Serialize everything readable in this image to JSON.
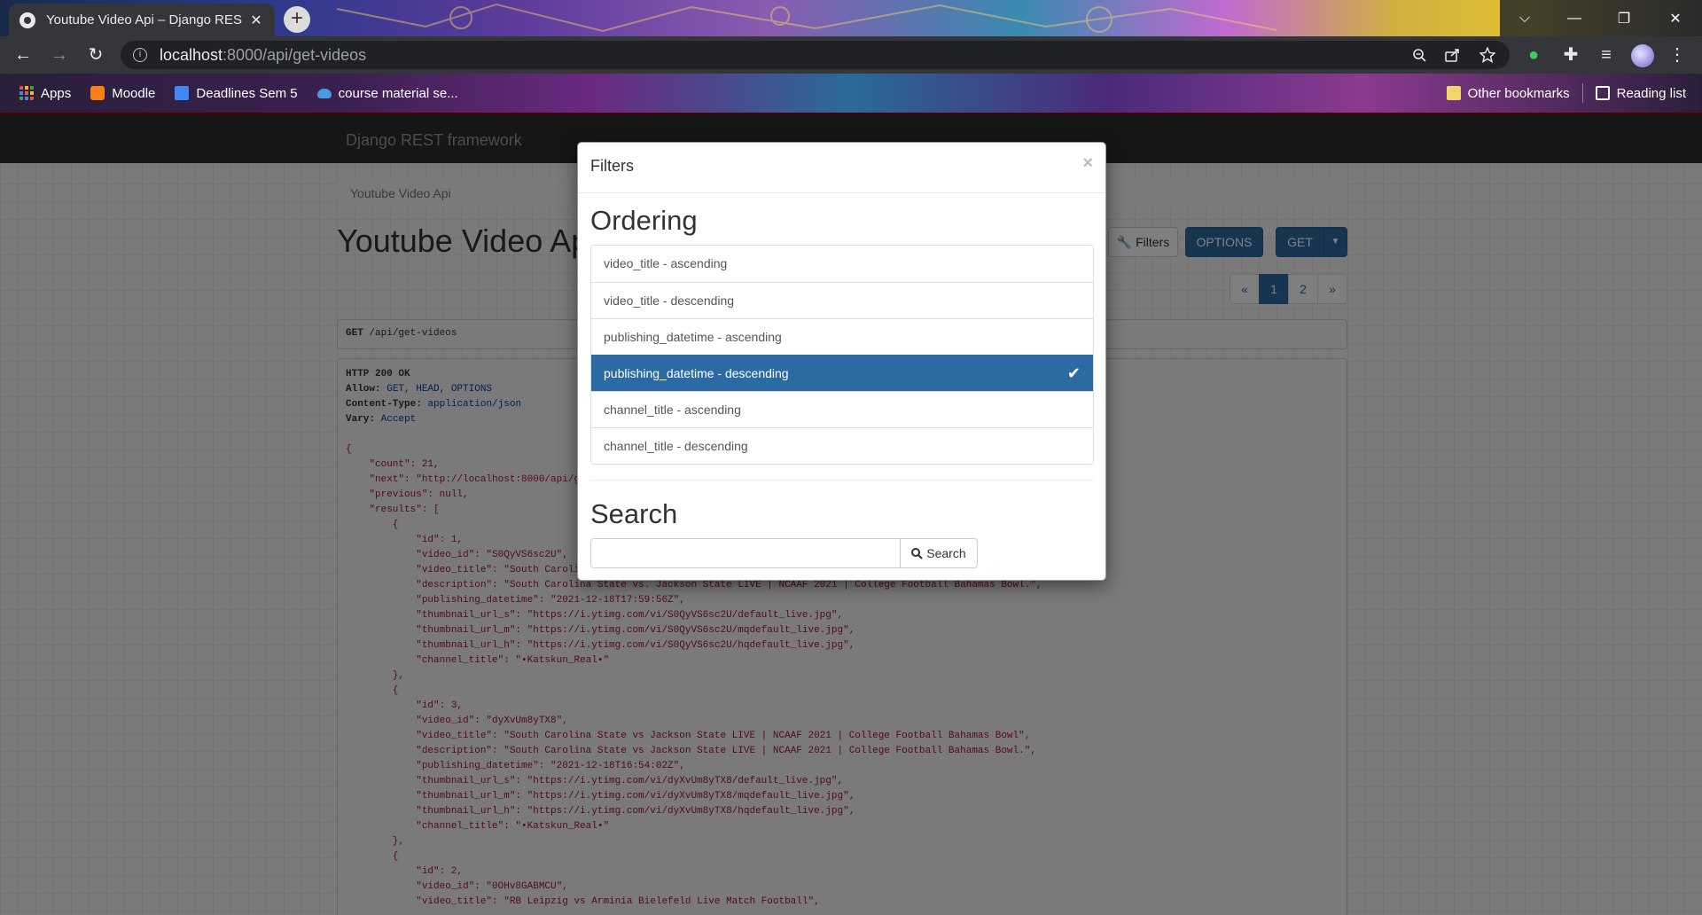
{
  "browser": {
    "tab_title": "Youtube Video Api – Django RES",
    "tab_close": "✕",
    "new_tab": "+",
    "url_host": "localhost",
    "url_path": ":8000/api/get-videos",
    "window_controls": [
      "⌵",
      "—",
      "❐",
      "✕"
    ]
  },
  "bookmarks": {
    "items": [
      {
        "label": "Apps",
        "icon": "apps-grid-icon",
        "color": "#e9573f"
      },
      {
        "label": "Moodle",
        "icon": "moodle-icon",
        "color": "#f98012"
      },
      {
        "label": "Deadlines Sem 5",
        "icon": "docs-icon",
        "color": "#4285f4"
      },
      {
        "label": "course material se...",
        "icon": "onedrive-icon",
        "color": "#4a9ae0"
      }
    ],
    "other": "Other bookmarks",
    "reading_list": "Reading list"
  },
  "app": {
    "brand": "Django REST framework",
    "breadcrumb": "Youtube Video Api",
    "page_title": "Youtube Video Api",
    "filters_label": "Filters",
    "options_label": "OPTIONS",
    "get_label": "GET",
    "pagination": [
      "«",
      "1",
      "2",
      "»"
    ],
    "request_method": "GET",
    "request_path": "/api/get-videos"
  },
  "response": {
    "status": "HTTP 200 OK",
    "headers": [
      {
        "name": "Allow:",
        "value": "GET, HEAD, OPTIONS"
      },
      {
        "name": "Content-Type:",
        "value": "application/json"
      },
      {
        "name": "Vary:",
        "value": "Accept"
      }
    ],
    "lines": [
      "{",
      "    \"count\": 21,",
      "    \"next\": \"http://localhost:8000/api/g",
      "    \"previous\": null,",
      "    \"results\": [",
      "        {",
      "            \"id\": 1,",
      "            \"video_id\": \"S0QyVS6sc2U\",",
      "            \"video_title\": \"South Caroli",
      "            \"description\": \"South Carolina State vs. Jackson State LIVE | NCAAF 2021 | College Football Bahamas Bowl.\",",
      "            \"publishing_datetime\": \"2021-12-18T17:59:56Z\",",
      "            \"thumbnail_url_s\": \"https://i.ytimg.com/vi/S0QyVS6sc2U/default_live.jpg\",",
      "            \"thumbnail_url_m\": \"https://i.ytimg.com/vi/S0QyVS6sc2U/mqdefault_live.jpg\",",
      "            \"thumbnail_url_h\": \"https://i.ytimg.com/vi/S0QyVS6sc2U/hqdefault_live.jpg\",",
      "            \"channel_title\": \"•Katskun_Real•\"",
      "        },",
      "        {",
      "            \"id\": 3,",
      "            \"video_id\": \"dyXvUm8yTX8\",",
      "            \"video_title\": \"South Carolina State vs Jackson State LIVE | NCAAF 2021 | College Football Bahamas Bowl\",",
      "            \"description\": \"South Carolina State vs Jackson State LIVE | NCAAF 2021 | College Football Bahamas Bowl.\",",
      "            \"publishing_datetime\": \"2021-12-18T16:54:02Z\",",
      "            \"thumbnail_url_s\": \"https://i.ytimg.com/vi/dyXvUm8yTX8/default_live.jpg\",",
      "            \"thumbnail_url_m\": \"https://i.ytimg.com/vi/dyXvUm8yTX8/mqdefault_live.jpg\",",
      "            \"thumbnail_url_h\": \"https://i.ytimg.com/vi/dyXvUm8yTX8/hqdefault_live.jpg\",",
      "            \"channel_title\": \"•Katskun_Real•\"",
      "        },",
      "        {",
      "            \"id\": 2,",
      "            \"video_id\": \"0OHv8GABMCU\",",
      "            \"video_title\": \"RB Leipzig vs Arminia Bielefeld Live Match Football\","
    ]
  },
  "modal": {
    "title": "Filters",
    "close": "×",
    "ordering_heading": "Ordering",
    "ordering_options": [
      {
        "label": "video_title - ascending",
        "active": false
      },
      {
        "label": "video_title - descending",
        "active": false
      },
      {
        "label": "publishing_datetime - ascending",
        "active": false
      },
      {
        "label": "publishing_datetime - descending",
        "active": true
      },
      {
        "label": "channel_title - ascending",
        "active": false
      },
      {
        "label": "channel_title - descending",
        "active": false
      }
    ],
    "check": "✔",
    "search_heading": "Search",
    "search_value": "",
    "search_button": "Search"
  },
  "colors": {
    "primary": "#2c6aa3",
    "navbar": "#2c2c2c",
    "navbar_accent": "#a30000"
  }
}
